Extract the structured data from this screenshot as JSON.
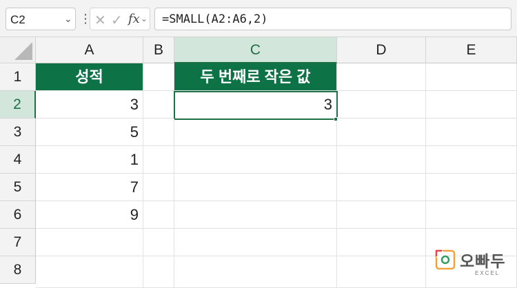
{
  "formula_bar": {
    "name_box": "C2",
    "name_box_caret": "⌄",
    "more_icon": "⋮",
    "cancel_icon": "✕",
    "enter_icon": "✓",
    "fx_label": "fx",
    "fx_caret": "⌄",
    "formula": "=SMALL(A2:A6,2)"
  },
  "columns": [
    "A",
    "B",
    "C",
    "D",
    "E"
  ],
  "rows": [
    "1",
    "2",
    "3",
    "4",
    "5",
    "6",
    "7",
    "8"
  ],
  "selected": {
    "column": "C",
    "row": "2"
  },
  "cells": {
    "A1": "성적",
    "A2": "3",
    "A3": "5",
    "A4": "1",
    "A5": "7",
    "A6": "9",
    "C1": "두 번째로 작은 값",
    "C2": "3"
  },
  "colors": {
    "header_fill": "#0d7347",
    "header_text": "#ffffff",
    "selection": "#1e7145",
    "selected_header_fill": "#d3e6dc"
  },
  "watermark": {
    "brand": "오빠두",
    "sub": "EXCEL"
  }
}
